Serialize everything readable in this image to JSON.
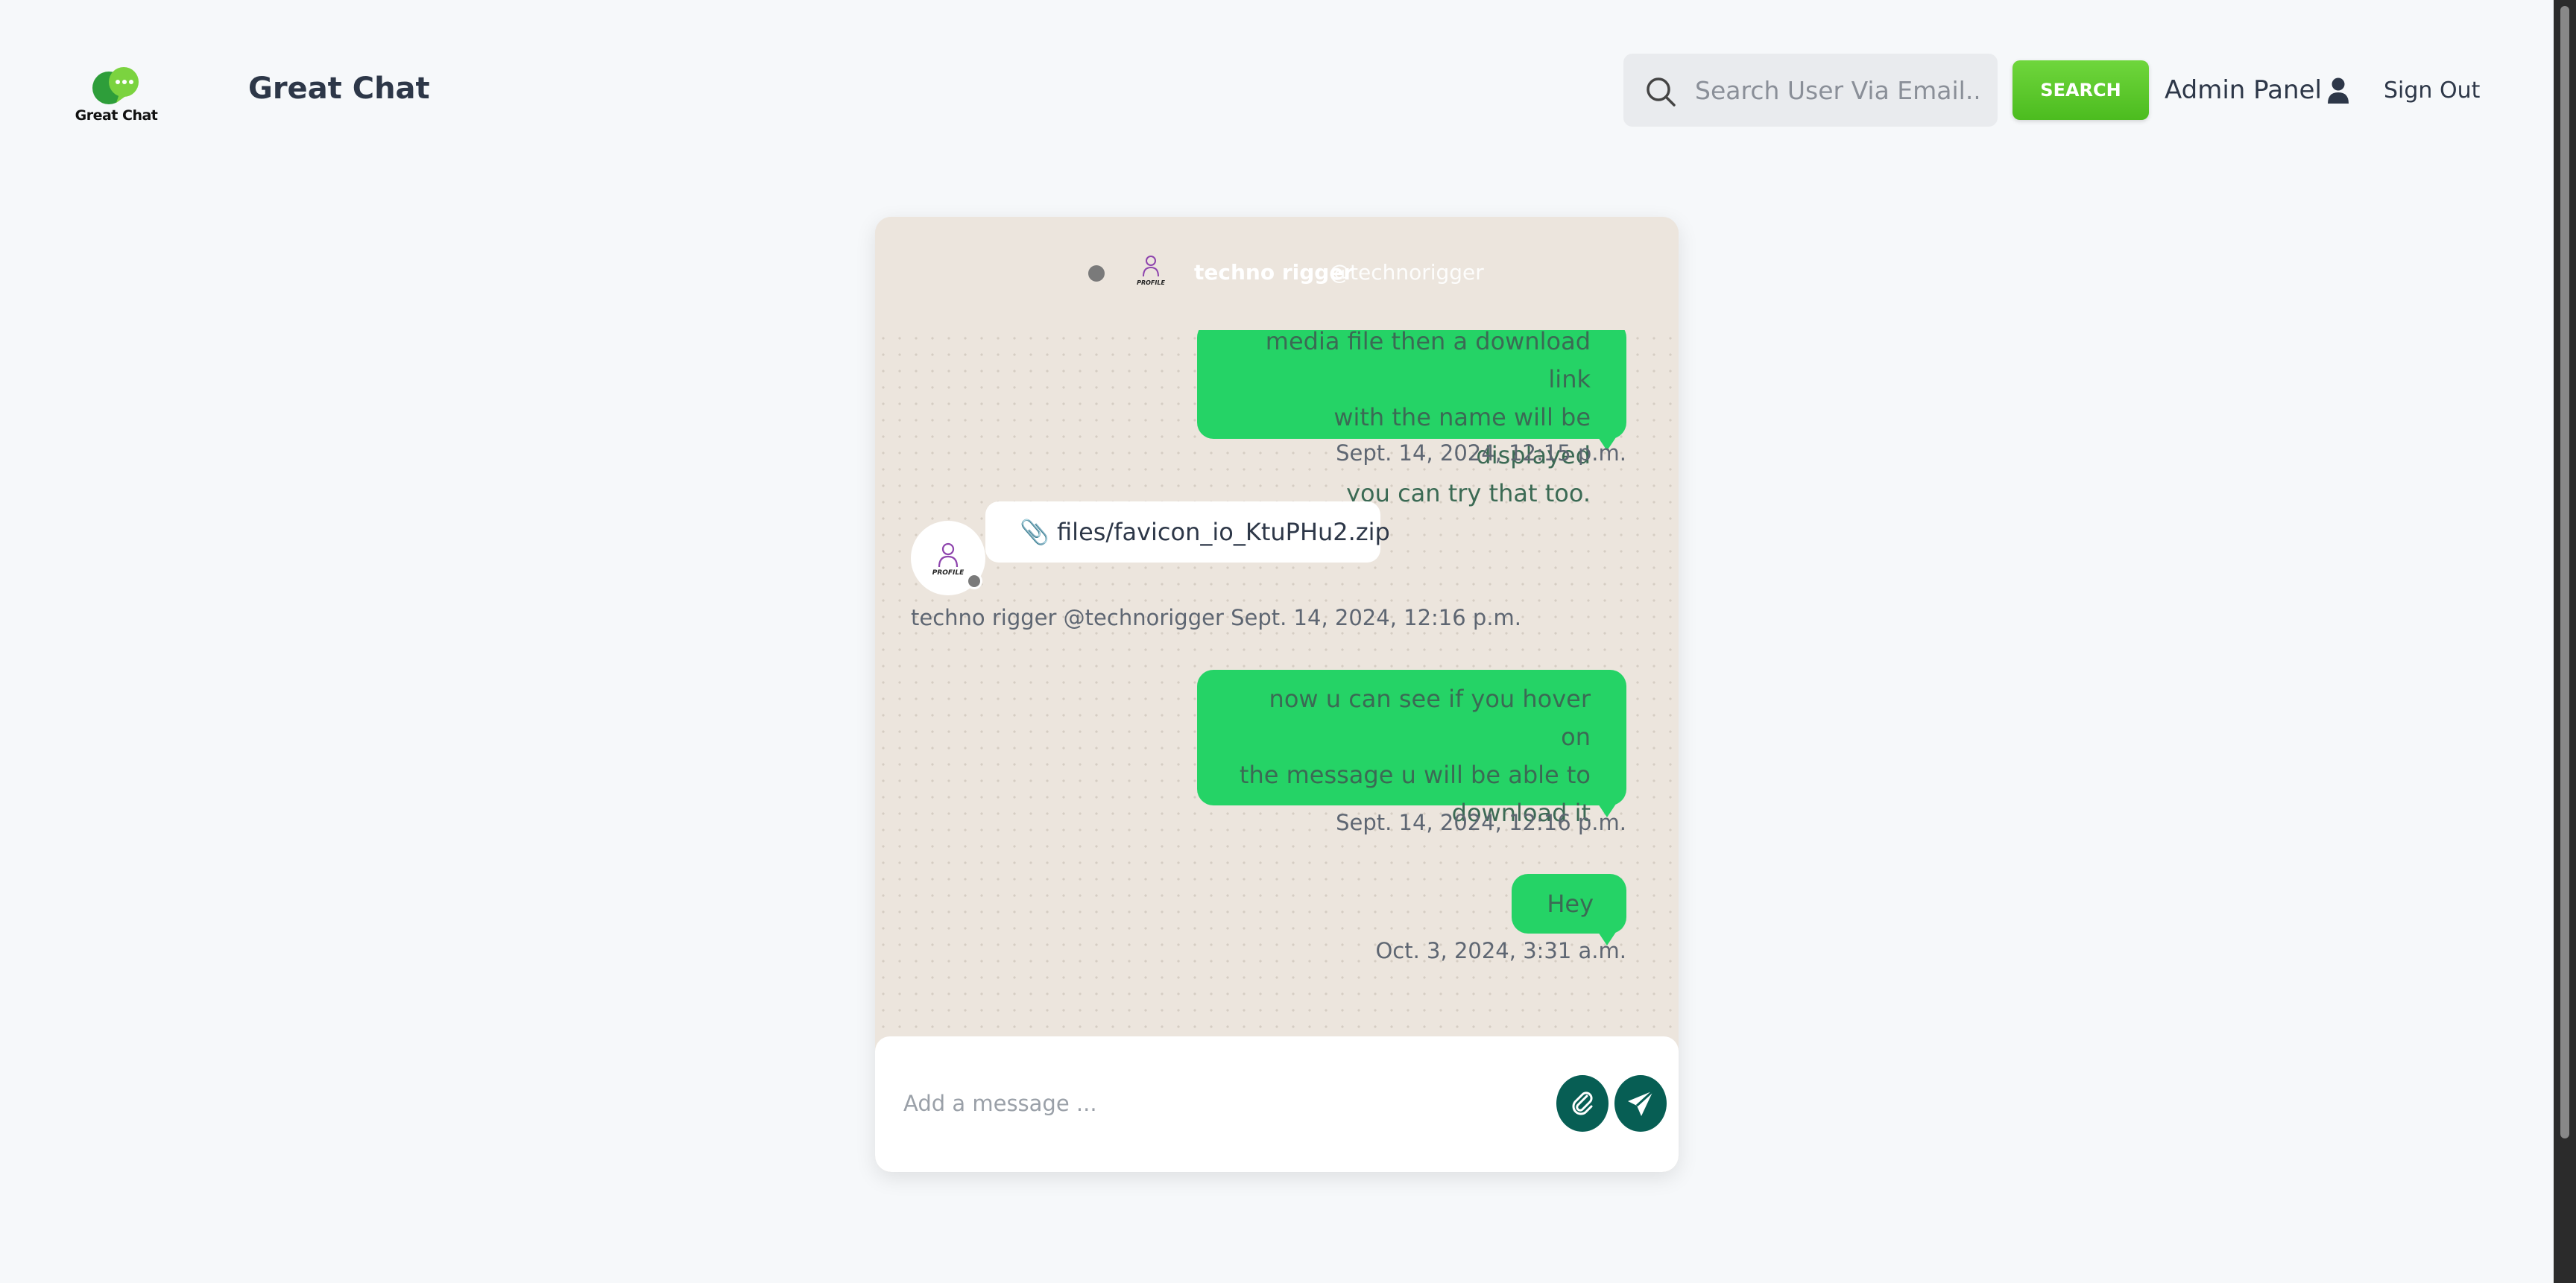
{
  "header": {
    "logo_text": "Great Chat",
    "brand_title": "Great Chat",
    "search_placeholder": "Search User Via Email...",
    "search_button": "SEARCH",
    "admin_link": "Admin Panel",
    "sign_out": "Sign Out"
  },
  "chat": {
    "contact_name": "techno rigger",
    "contact_handle": "@technorigger",
    "avatar_text": "PROFILE",
    "messages": [
      {
        "direction": "outgoing",
        "lines": [
          "media file then a download link",
          "with the name will be displayed",
          "you can try that too."
        ],
        "time": "Sept. 14, 2024, 12:15 p.m."
      },
      {
        "direction": "incoming",
        "text": "📎 files/favicon_io_KtuPHu2.zip",
        "meta": "techno rigger @technorigger Sept. 14, 2024, 12:16 p.m."
      },
      {
        "direction": "outgoing",
        "lines": [
          "now u can see if you hover on",
          "the message u will be able to",
          "download it"
        ],
        "time": "Sept. 14, 2024, 12:16 p.m."
      },
      {
        "direction": "outgoing",
        "lines": [
          "Hey"
        ],
        "time": "Oct. 3, 2024, 3:31 a.m."
      }
    ],
    "composer_placeholder": "Add a message ..."
  },
  "colors": {
    "accent_green": "#25d366",
    "dark_teal": "#075e54",
    "search_green": "#5cc92c",
    "chat_bg": "#ece5dd"
  },
  "icons": [
    "logo-icon",
    "search-icon",
    "user-icon",
    "paperclip-icon",
    "attach-icon",
    "send-icon"
  ]
}
